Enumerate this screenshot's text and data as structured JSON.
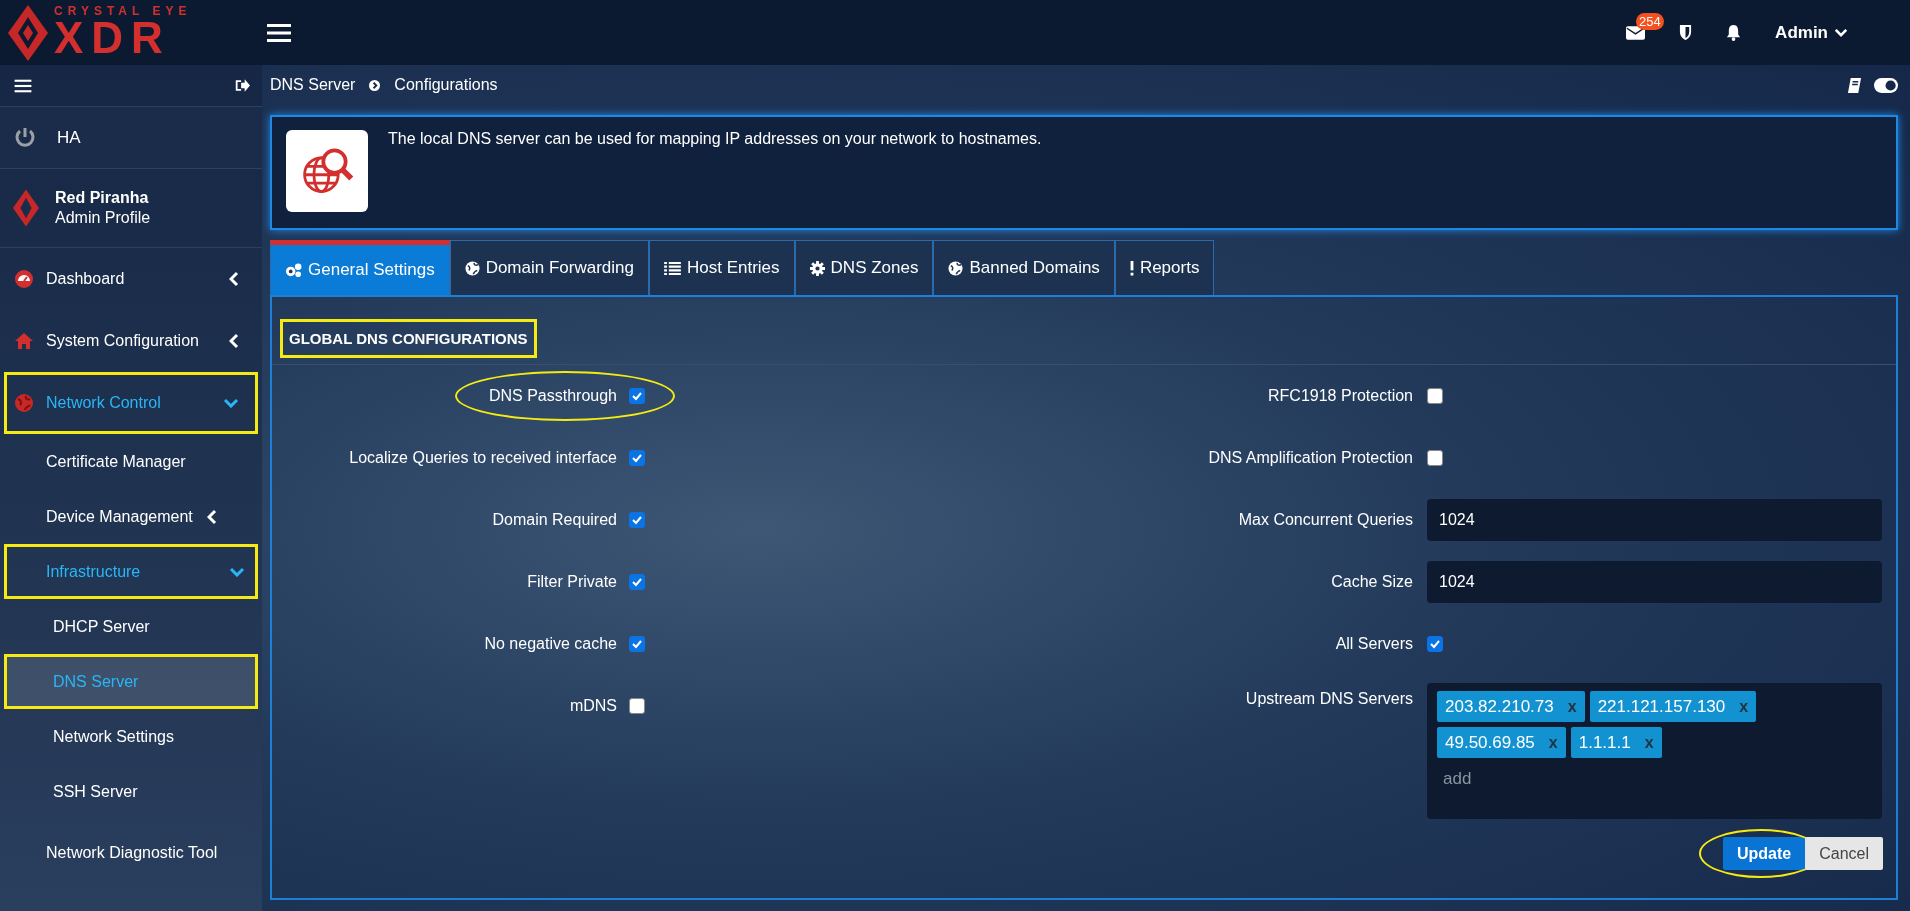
{
  "header": {
    "logo_tagline": "CRYSTAL EYE",
    "logo_text": "XDR",
    "mail_count": "254",
    "user": "Admin"
  },
  "sidebar": {
    "ha": {
      "label": "HA"
    },
    "profile": {
      "name": "Red Piranha",
      "role": "Admin Profile"
    },
    "menu": [
      {
        "label": "Dashboard",
        "expanded": false,
        "selected": false,
        "highlighted": false
      },
      {
        "label": "System Configuration",
        "expanded": false,
        "selected": false,
        "highlighted": false
      },
      {
        "label": "Network Control",
        "expanded": true,
        "selected": false,
        "highlighted": true,
        "children": [
          {
            "label": "Certificate Manager",
            "selected": false,
            "highlighted": false
          },
          {
            "label": "Device Management",
            "expanded": false,
            "selected": false,
            "highlighted": false
          },
          {
            "label": "Infrastructure",
            "expanded": true,
            "selected": false,
            "highlighted": true,
            "children": [
              {
                "label": "DHCP Server",
                "selected": false,
                "highlighted": false
              },
              {
                "label": "DNS Server",
                "selected": true,
                "highlighted": true
              },
              {
                "label": "Network Settings",
                "selected": false,
                "highlighted": false
              },
              {
                "label": "SSH Server",
                "selected": false,
                "highlighted": false
              }
            ]
          },
          {
            "label": "Network Diagnostic Tool",
            "selected": false,
            "highlighted": false
          }
        ]
      }
    ]
  },
  "breadcrumb": [
    "DNS Server",
    "Configurations"
  ],
  "info": {
    "text": "The local DNS server can be used for mapping IP addresses on your network to hostnames."
  },
  "tabs": [
    {
      "label": "General Settings",
      "selected": true
    },
    {
      "label": "Domain Forwarding",
      "selected": false
    },
    {
      "label": "Host Entries",
      "selected": false
    },
    {
      "label": "DNS Zones",
      "selected": false
    },
    {
      "label": "Banned Domains",
      "selected": false
    },
    {
      "label": "Reports",
      "selected": false
    }
  ],
  "form": {
    "title": "GLOBAL DNS CONFIGURATIONS",
    "title_highlighted": true,
    "left": [
      {
        "kind": "checkbox",
        "label": "DNS Passthrough",
        "checked": true,
        "circled": true
      },
      {
        "kind": "checkbox",
        "label": "Localize Queries to received interface",
        "checked": true
      },
      {
        "kind": "checkbox",
        "label": "Domain Required",
        "checked": true
      },
      {
        "kind": "checkbox",
        "label": "Filter Private",
        "checked": true
      },
      {
        "kind": "checkbox",
        "label": "No negative cache",
        "checked": true
      },
      {
        "kind": "checkbox",
        "label": "mDNS",
        "checked": false
      }
    ],
    "right": [
      {
        "kind": "checkbox",
        "label": "RFC1918 Protection",
        "checked": false
      },
      {
        "kind": "checkbox",
        "label": "DNS Amplification Protection",
        "checked": false
      },
      {
        "kind": "input",
        "label": "Max Concurrent Queries",
        "value": "1024"
      },
      {
        "kind": "input",
        "label": "Cache Size",
        "value": "1024"
      },
      {
        "kind": "checkbox",
        "label": "All Servers",
        "checked": true
      },
      {
        "kind": "tags",
        "label": "Upstream DNS Servers",
        "placeholder": "add",
        "tags": [
          {
            "value": "203.82.210.73",
            "remove": "x"
          },
          {
            "value": "221.121.157.130",
            "remove": "x"
          },
          {
            "value": "49.50.69.85",
            "remove": "x"
          },
          {
            "value": "1.1.1.1",
            "remove": "x"
          }
        ]
      }
    ],
    "buttons": [
      {
        "label": "Update",
        "kind": "primary",
        "circled": true
      },
      {
        "label": "Cancel",
        "kind": "secondary",
        "circled": false
      }
    ]
  }
}
